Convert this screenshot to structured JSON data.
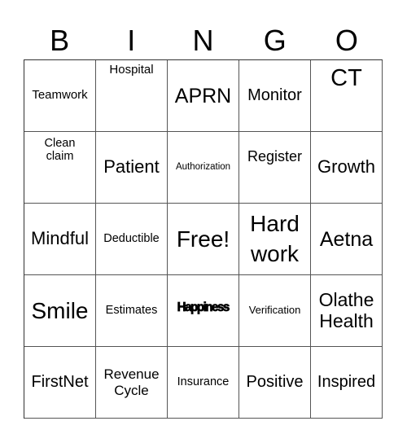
{
  "header": [
    "B",
    "I",
    "N",
    "G",
    "O"
  ],
  "cells": [
    [
      "Teamwork",
      "Hospital",
      "APRN",
      "Monitor",
      "CT"
    ],
    [
      "Clean claim",
      "Patient",
      "Authorization",
      "Register",
      "Growth"
    ],
    [
      "Mindful",
      "Deductible",
      "Free!",
      "Hard work",
      "Aetna"
    ],
    [
      "Smile",
      "Estimates",
      "Happiness",
      "Verification",
      "Olathe Health"
    ],
    [
      "FirstNet",
      "Revenue Cycle",
      "Insurance",
      "Positive",
      "Inspired"
    ]
  ]
}
